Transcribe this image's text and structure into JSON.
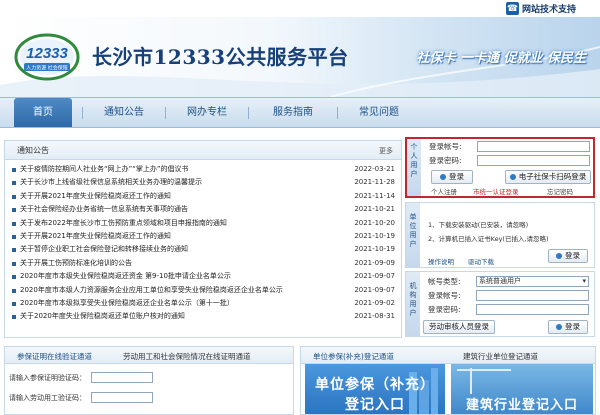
{
  "support": {
    "icon": "phone-icon",
    "label": "网站技术支持"
  },
  "header": {
    "logo_number": "12333",
    "logo_caption": "人力资源 社会保障",
    "title": "长沙市12333公共服务平台",
    "slogan": "社保卡 一卡通 促就业 保民生"
  },
  "nav": {
    "items": [
      "首页",
      "通知公告",
      "网办专栏",
      "服务指南",
      "常见问题"
    ],
    "active_index": 0
  },
  "notice": {
    "title": "通知公告",
    "more": "更多",
    "items": [
      {
        "title": "关于疫情防控期间人社业务“网上办”“掌上办”的倡议书",
        "date": "2022-03-21"
      },
      {
        "title": "关于长沙市上线省级社保信息系统相关业务办理的温馨提示",
        "date": "2021-11-28"
      },
      {
        "title": "关于开展2021年度失业保险稳岗返还工作的通知",
        "date": "2021-11-14"
      },
      {
        "title": "关于社会保险经办业务省统一信息系统有关事项的通告",
        "date": "2021-10-21"
      },
      {
        "title": "关于发布2022年度长沙市工伤预防重点领域和项目申报指南的通知",
        "date": "2021-10-20"
      },
      {
        "title": "关于开展2021年度失业保险稳岗返还工作的通知",
        "date": "2021-10-19"
      },
      {
        "title": "关于暂停企业职工社会保险登记和转移接续业务的通知",
        "date": "2021-10-19"
      },
      {
        "title": "关于开展工伤预防标准化培训的公告",
        "date": "2021-09-09"
      },
      {
        "title": "2020年度市本级失业保险稳岗返还资金 第9-10批申请企业名单公示",
        "date": "2021-09-07"
      },
      {
        "title": "2020年度市本级人力资源服务企业应用工单位和享受失业保险稳岗返还企业名单公示",
        "date": "2021-09-07"
      },
      {
        "title": "2020年度市本级拟享受失业保险稳岗返还企业名单公示（第十一批）",
        "date": "2021-09-02"
      },
      {
        "title": "关于2020年度失业保险稳岗返还单位账户核对的通知",
        "date": "2021-08-31"
      }
    ]
  },
  "login_personal": {
    "tab": [
      "个",
      "人",
      "用",
      "户"
    ],
    "account_label": "登录帐号:",
    "password_label": "登录密码:",
    "login_button": "登录",
    "scan_button": "电子社保卡扫码登录",
    "user_register": "个人注册",
    "cert_login": "市统一认证登录",
    "forgot": "忘记密码"
  },
  "login_unit": {
    "tab": [
      "单",
      "位",
      "用",
      "户"
    ],
    "step1": "1、下载安装驱动(已安装，请忽略)",
    "step2": "2、计算机已插入证书Key(已插入,请忽略)",
    "login_button": "登录",
    "help": "操作说明",
    "download": "驱动下载"
  },
  "login_agency": {
    "tab": [
      "机",
      "构",
      "用",
      "户"
    ],
    "account_type_label": "帐号类型:",
    "account_type_value": "系统普通用户",
    "account_label": "登录帐号:",
    "password_label": "登录密码:",
    "login_button": "登录",
    "register_button": "劳动审核人员登录"
  },
  "bottom_left": {
    "tab1": "参保证明在线验证通道",
    "tab2": "劳动用工和社会保险情况在线证明通道",
    "field1_label": "请输入参保证明验证码：",
    "field2_label": "请输入劳动用工验证码："
  },
  "bottom_right": {
    "tab1": "单位参保(补充)登记通道",
    "tab2": "建筑行业单位登记通道",
    "banner1_line1": "单位参保（补充）",
    "banner1_line2": "登记入口",
    "banner2": "建筑行业登记入口"
  },
  "colors": {
    "brand": "#17407a",
    "nav_active": "#2d6aa8",
    "alert_border": "#c1272d",
    "link_red": "#c1272d"
  }
}
